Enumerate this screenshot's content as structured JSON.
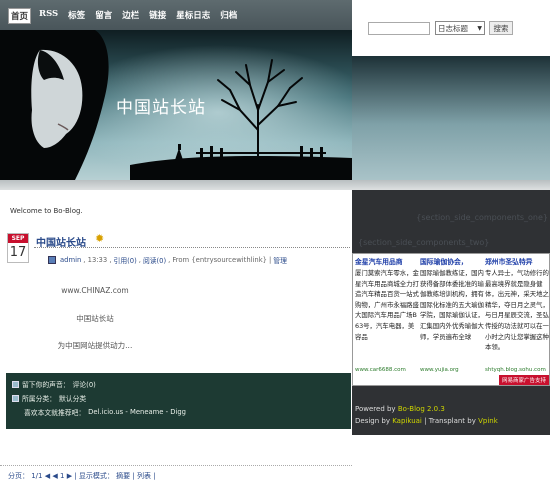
{
  "nav": {
    "items": [
      "首页",
      "RSS",
      "标签",
      "留言",
      "边栏",
      "链接",
      "星标日志",
      "归档"
    ],
    "active_index": 0
  },
  "search": {
    "value": "",
    "select_value": "日志标题",
    "button_label": "搜索"
  },
  "banner": {
    "site_title": "中国站长站"
  },
  "welcome_text": "Welcome to Bo-Blog.",
  "post": {
    "month": "SEP",
    "day": "17",
    "title": "中国站长站",
    "meta": {
      "author": "admin",
      "time": ", 13:33 ,",
      "refs": "引用(0)",
      "reads": "阅读(0)",
      "source": "From {entrysourcewithlink}",
      "sep": "|",
      "manage": "管理"
    },
    "lines": [
      "www.CHINAZ.com",
      "中国站长站",
      "为中国网站提供动力..."
    ]
  },
  "comments_box": {
    "leave_voice": "留下你的声音：",
    "comments_link": "评论(0)",
    "category_label": "所属分类：",
    "category_value": "默认分类",
    "like_label": "喜欢本文就推荐吧：",
    "share": "Del.icio.us - Meneame - Digg"
  },
  "pagination": {
    "text": "分页： 1/1",
    "first": "◀",
    "prev": "◀",
    "current": "1",
    "next": "▶",
    "mode_label": "| 显示模式：",
    "mode_summary": "摘要",
    "mode_sep": "|",
    "mode_list": "列表",
    "end": "|"
  },
  "sidebar": {
    "component_one": "{section_side_components_one}",
    "component_two": "{section_side_components_two}"
  },
  "ads": [
    {
      "title": "金星汽车用品商",
      "body": "厦门莫索汽车零水，金星汽车用品商城全力打造汽车精品百货一站式购物，广州市永福路盛大国际汽车用品广场B63号，汽车电器，美容品",
      "url": "www.car6688.com"
    },
    {
      "title": "国际瑜伽协会，",
      "body": "国际瑜伽教练证，国内获得备部体委批准的瑜伽教练培训机构，拥有国际化标准的五大瑜伽学院，国际瑜伽认证，汇集国内外优秀瑜伽大师，学员遍布全球",
      "url": "www.yujia.org"
    },
    {
      "title": "郑州市圣弘特异",
      "body": "专人异士，气功修行的最高境界就是隐身健体，出元神，采天地之精华，夺日月之灵气，与日月星辰交流，圣弘传授的功法就可以在一小时之内让您掌握这种本领。",
      "url": "shtyqh.blog.sohu.com"
    }
  ],
  "ad_footer": "网易商家广告支持",
  "footer": {
    "powered_by": "Powered by",
    "powered_name": "Bo-Blog 2.0.3",
    "design_by": "Design by",
    "design_name": "Kapikuai",
    "transplant": "| Transplant by",
    "transplant_name": "Vpink"
  },
  "colors": {
    "nav_bg": "#4f5c60",
    "date_month_bg": "#c8102e",
    "link": "#2a4a8a",
    "comments_bg": "#1d3a33",
    "sidebar_bg": "#2f3134",
    "footer_accent": "#cfd600"
  }
}
